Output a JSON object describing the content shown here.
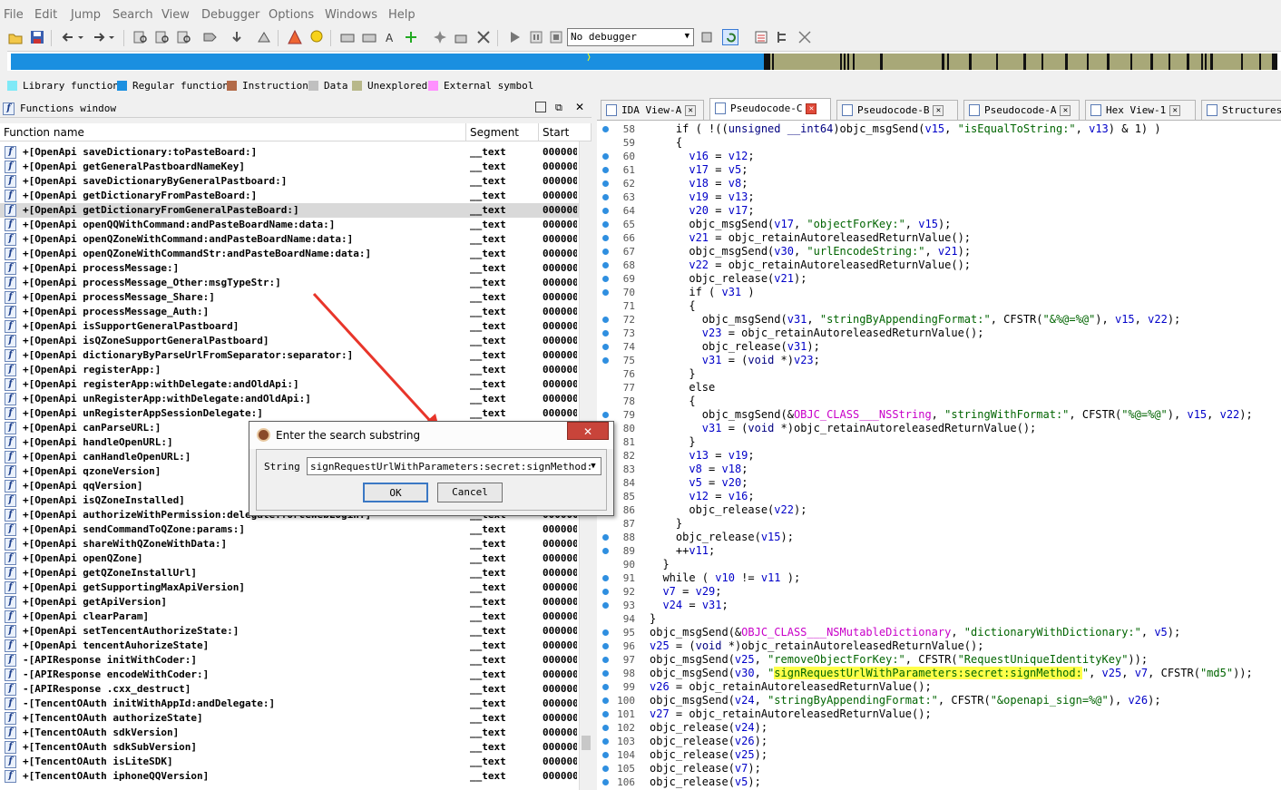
{
  "menu": [
    "File",
    "Edit",
    "Jump",
    "Search",
    "View",
    "Debugger",
    "Options",
    "Windows",
    "Help"
  ],
  "debugger_select": "No debugger",
  "legend": [
    {
      "label": "Library function",
      "color": "#7fe9f7"
    },
    {
      "label": "Regular function",
      "color": "#1a8fe0"
    },
    {
      "label": "Instruction",
      "color": "#b26a48"
    },
    {
      "label": "Data",
      "color": "#c0c0c0"
    },
    {
      "label": "Unexplored",
      "color": "#b8b88a"
    },
    {
      "label": "External symbol",
      "color": "#ff90ff"
    }
  ],
  "functions_window": {
    "title": "Functions window",
    "columns": [
      "Function name",
      "Segment",
      "Start"
    ],
    "rows": [
      {
        "name": "+[OpenApi saveDictionary:toPasteBoard:]",
        "segment": "__text",
        "start": "000000"
      },
      {
        "name": "+[OpenApi getGeneralPastboardNameKey]",
        "segment": "__text",
        "start": "000000"
      },
      {
        "name": "+[OpenApi saveDictionaryByGeneralPastboard:]",
        "segment": "__text",
        "start": "000000"
      },
      {
        "name": "+[OpenApi getDictionaryFromPasteBoard:]",
        "segment": "__text",
        "start": "000000"
      },
      {
        "name": "+[OpenApi getDictionaryFromGeneralPasteBoard:]",
        "segment": "__text",
        "start": "000000"
      },
      {
        "name": "+[OpenApi openQQWithCommand:andPasteBoardName:data:]",
        "segment": "__text",
        "start": "000000"
      },
      {
        "name": "+[OpenApi openQZoneWithCommand:andPasteBoardName:data:]",
        "segment": "__text",
        "start": "000000"
      },
      {
        "name": "+[OpenApi openQZoneWithCommandStr:andPasteBoardName:data:]",
        "segment": "__text",
        "start": "000000"
      },
      {
        "name": "+[OpenApi processMessage:]",
        "segment": "__text",
        "start": "000000"
      },
      {
        "name": "+[OpenApi processMessage_Other:msgTypeStr:]",
        "segment": "__text",
        "start": "000000"
      },
      {
        "name": "+[OpenApi processMessage_Share:]",
        "segment": "__text",
        "start": "000000"
      },
      {
        "name": "+[OpenApi processMessage_Auth:]",
        "segment": "__text",
        "start": "000000"
      },
      {
        "name": "+[OpenApi isSupportGeneralPastboard]",
        "segment": "__text",
        "start": "000000"
      },
      {
        "name": "+[OpenApi isQZoneSupportGeneralPastboard]",
        "segment": "__text",
        "start": "000000"
      },
      {
        "name": "+[OpenApi dictionaryByParseUrlFromSeparator:separator:]",
        "segment": "__text",
        "start": "000000"
      },
      {
        "name": "+[OpenApi registerApp:]",
        "segment": "__text",
        "start": "000000"
      },
      {
        "name": "+[OpenApi registerApp:withDelegate:andOldApi:]",
        "segment": "__text",
        "start": "000000"
      },
      {
        "name": "+[OpenApi unRegisterApp:withDelegate:andOldApi:]",
        "segment": "__text",
        "start": "000000"
      },
      {
        "name": "+[OpenApi unRegisterAppSessionDelegate:]",
        "segment": "__text",
        "start": "000000"
      },
      {
        "name": "+[OpenApi canParseURL:]",
        "segment": "__text",
        "start": "000000"
      },
      {
        "name": "+[OpenApi handleOpenURL:]",
        "segment": "__text",
        "start": "000000"
      },
      {
        "name": "+[OpenApi canHandleOpenURL:]",
        "segment": "__text",
        "start": "000000"
      },
      {
        "name": "+[OpenApi qzoneVersion]",
        "segment": "__text",
        "start": "000000"
      },
      {
        "name": "+[OpenApi qqVersion]",
        "segment": "__text",
        "start": "000000"
      },
      {
        "name": "+[OpenApi isQZoneInstalled]",
        "segment": "__text",
        "start": "000000"
      },
      {
        "name": "+[OpenApi authorizeWithPermission:delegate:forceWebLogin:]",
        "segment": "__text",
        "start": "000000"
      },
      {
        "name": "+[OpenApi sendCommandToQZone:params:]",
        "segment": "__text",
        "start": "000000"
      },
      {
        "name": "+[OpenApi shareWithQZoneWithData:]",
        "segment": "__text",
        "start": "000000"
      },
      {
        "name": "+[OpenApi openQZone]",
        "segment": "__text",
        "start": "000000"
      },
      {
        "name": "+[OpenApi getQZoneInstallUrl]",
        "segment": "__text",
        "start": "000000"
      },
      {
        "name": "+[OpenApi getSupportingMaxApiVersion]",
        "segment": "__text",
        "start": "000000"
      },
      {
        "name": "+[OpenApi getApiVersion]",
        "segment": "__text",
        "start": "000000"
      },
      {
        "name": "+[OpenApi clearParam]",
        "segment": "__text",
        "start": "000000"
      },
      {
        "name": "+[OpenApi setTencentAuthorizeState:]",
        "segment": "__text",
        "start": "000000"
      },
      {
        "name": "+[OpenApi tencentAuhorizeState]",
        "segment": "__text",
        "start": "000000"
      },
      {
        "name": "-[APIResponse initWithCoder:]",
        "segment": "__text",
        "start": "000000"
      },
      {
        "name": "-[APIResponse encodeWithCoder:]",
        "segment": "__text",
        "start": "000000"
      },
      {
        "name": "-[APIResponse .cxx_destruct]",
        "segment": "__text",
        "start": "000000"
      },
      {
        "name": "-[TencentOAuth initWithAppId:andDelegate:]",
        "segment": "__text",
        "start": "000000"
      },
      {
        "name": "+[TencentOAuth authorizeState]",
        "segment": "__text",
        "start": "000000"
      },
      {
        "name": "+[TencentOAuth sdkVersion]",
        "segment": "__text",
        "start": "000000"
      },
      {
        "name": "+[TencentOAuth sdkSubVersion]",
        "segment": "__text",
        "start": "000000"
      },
      {
        "name": "+[TencentOAuth isLiteSDK]",
        "segment": "__text",
        "start": "000000"
      },
      {
        "name": "+[TencentOAuth iphoneQQVersion]",
        "segment": "__text",
        "start": "000000"
      }
    ]
  },
  "tabs": [
    {
      "label": "IDA View-A",
      "active": false
    },
    {
      "label": "Pseudocode-C",
      "active": true
    },
    {
      "label": "Pseudocode-B",
      "active": false
    },
    {
      "label": "Pseudocode-A",
      "active": false
    },
    {
      "label": "Hex View-1",
      "active": false
    },
    {
      "label": "Structures",
      "active": false
    }
  ],
  "code": [
    {
      "n": "58",
      "dot": true,
      "t": "    if ( !((unsigned __int64)objc_msgSend(v15, \"isEqualToString:\", v13) & 1) )"
    },
    {
      "n": "59",
      "dot": false,
      "t": "    {"
    },
    {
      "n": "60",
      "dot": true,
      "t": "      v16 = v12;"
    },
    {
      "n": "61",
      "dot": true,
      "t": "      v17 = v5;"
    },
    {
      "n": "62",
      "dot": true,
      "t": "      v18 = v8;"
    },
    {
      "n": "63",
      "dot": true,
      "t": "      v19 = v13;"
    },
    {
      "n": "64",
      "dot": true,
      "t": "      v20 = v17;"
    },
    {
      "n": "65",
      "dot": true,
      "t": "      objc_msgSend(v17, \"objectForKey:\", v15);"
    },
    {
      "n": "66",
      "dot": true,
      "t": "      v21 = objc_retainAutoreleasedReturnValue();"
    },
    {
      "n": "67",
      "dot": true,
      "t": "      objc_msgSend(v30, \"urlEncodeString:\", v21);"
    },
    {
      "n": "68",
      "dot": true,
      "t": "      v22 = objc_retainAutoreleasedReturnValue();"
    },
    {
      "n": "69",
      "dot": true,
      "t": "      objc_release(v21);"
    },
    {
      "n": "70",
      "dot": true,
      "t": "      if ( v31 )"
    },
    {
      "n": "71",
      "dot": false,
      "t": "      {"
    },
    {
      "n": "72",
      "dot": true,
      "t": "        objc_msgSend(v31, \"stringByAppendingFormat:\", CFSTR(\"&%@=%@\"), v15, v22);"
    },
    {
      "n": "73",
      "dot": true,
      "t": "        v23 = objc_retainAutoreleasedReturnValue();"
    },
    {
      "n": "74",
      "dot": true,
      "t": "        objc_release(v31);"
    },
    {
      "n": "75",
      "dot": true,
      "t": "        v31 = (void *)v23;"
    },
    {
      "n": "76",
      "dot": false,
      "t": "      }"
    },
    {
      "n": "77",
      "dot": false,
      "t": "      else"
    },
    {
      "n": "78",
      "dot": false,
      "t": "      {"
    },
    {
      "n": "79",
      "dot": true,
      "t": "        objc_msgSend(&OBJC_CLASS___NSString, \"stringWithFormat:\", CFSTR(\"%@=%@\"), v15, v22);"
    },
    {
      "n": "80",
      "dot": true,
      "t": "        v31 = (void *)objc_retainAutoreleasedReturnValue();"
    },
    {
      "n": "81",
      "dot": false,
      "t": "      }"
    },
    {
      "n": "82",
      "dot": true,
      "t": "      v13 = v19;"
    },
    {
      "n": "83",
      "dot": true,
      "t": "      v8 = v18;"
    },
    {
      "n": "84",
      "dot": true,
      "t": "      v5 = v20;"
    },
    {
      "n": "85",
      "dot": true,
      "t": "      v12 = v16;"
    },
    {
      "n": "86",
      "dot": true,
      "t": "      objc_release(v22);"
    },
    {
      "n": "87",
      "dot": false,
      "t": "    }"
    },
    {
      "n": "88",
      "dot": true,
      "t": "    objc_release(v15);"
    },
    {
      "n": "89",
      "dot": true,
      "t": "    ++v11;"
    },
    {
      "n": "90",
      "dot": false,
      "t": "  }"
    },
    {
      "n": "91",
      "dot": true,
      "t": "  while ( v10 != v11 );"
    },
    {
      "n": "92",
      "dot": true,
      "t": "  v7 = v29;"
    },
    {
      "n": "93",
      "dot": true,
      "t": "  v24 = v31;"
    },
    {
      "n": "94",
      "dot": false,
      "t": "}"
    },
    {
      "n": "95",
      "dot": true,
      "t": "objc_msgSend(&OBJC_CLASS___NSMutableDictionary, \"dictionaryWithDictionary:\", v5);"
    },
    {
      "n": "96",
      "dot": true,
      "t": "v25 = (void *)objc_retainAutoreleasedReturnValue();"
    },
    {
      "n": "97",
      "dot": true,
      "t": "objc_msgSend(v25, \"removeObjectForKey:\", CFSTR(\"RequestUniqueIdentityKey\"));"
    },
    {
      "n": "98",
      "dot": true,
      "t": "objc_msgSend(v30, \"signRequestUrlWithParameters:secret:signMethod:\", v25, v7, CFSTR(\"md5\"));"
    },
    {
      "n": "99",
      "dot": true,
      "t": "v26 = objc_retainAutoreleasedReturnValue();"
    },
    {
      "n": "100",
      "dot": true,
      "t": "objc_msgSend(v24, \"stringByAppendingFormat:\", CFSTR(\"&openapi_sign=%@\"), v26);"
    },
    {
      "n": "101",
      "dot": true,
      "t": "v27 = objc_retainAutoreleasedReturnValue();"
    },
    {
      "n": "102",
      "dot": true,
      "t": "objc_release(v24);"
    },
    {
      "n": "103",
      "dot": true,
      "t": "objc_release(v26);"
    },
    {
      "n": "104",
      "dot": true,
      "t": "objc_release(v25);"
    },
    {
      "n": "105",
      "dot": true,
      "t": "objc_release(v7);"
    },
    {
      "n": "106",
      "dot": true,
      "t": "objc_release(v5);"
    }
  ],
  "highlight_term": "signRequestUrlWithParameters:secret:signMethod:",
  "dialog": {
    "title": "Enter the search substring",
    "label": "String",
    "value": "signRequestUrlWithParameters:secret:signMethod:",
    "ok": "OK",
    "cancel": "Cancel",
    "close": "✕"
  }
}
